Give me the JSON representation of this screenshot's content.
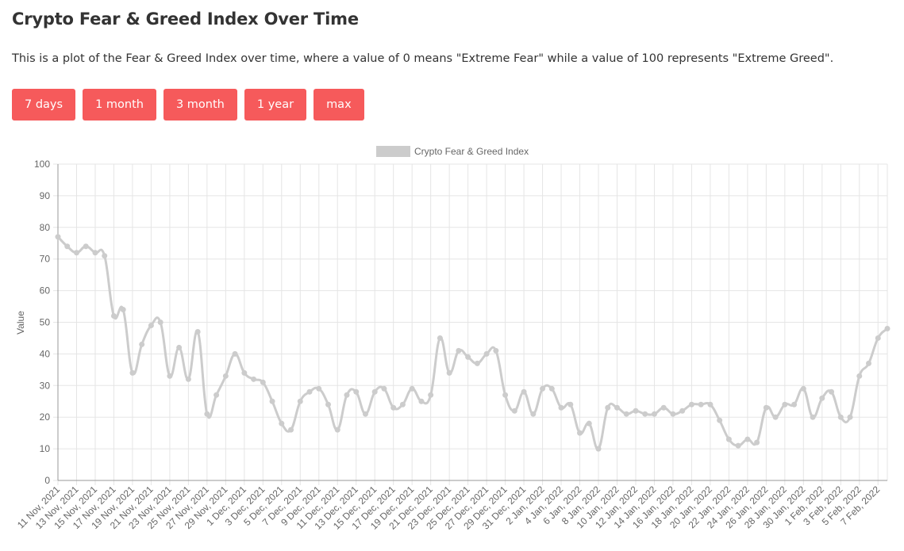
{
  "header": {
    "title": "Crypto Fear & Greed Index Over Time",
    "description": "This is a plot of the Fear & Greed Index over time, where a value of 0 means \"Extreme Fear\" while a value of 100 represents \"Extreme Greed\"."
  },
  "range_buttons": [
    {
      "label": "7 days"
    },
    {
      "label": "1 month"
    },
    {
      "label": "3 month"
    },
    {
      "label": "1 year"
    },
    {
      "label": "max"
    }
  ],
  "colors": {
    "button_bg": "#f65a5b",
    "series": "#cccccc"
  },
  "chart_data": {
    "type": "line",
    "title": "",
    "xlabel": "",
    "ylabel": "Value",
    "ylim": [
      0,
      100
    ],
    "y_ticks": [
      0,
      10,
      20,
      30,
      40,
      50,
      60,
      70,
      80,
      90,
      100
    ],
    "grid": true,
    "legend_position": "top-center",
    "x": [
      "11 Nov, 2021",
      "12 Nov, 2021",
      "13 Nov, 2021",
      "14 Nov, 2021",
      "15 Nov, 2021",
      "16 Nov, 2021",
      "17 Nov, 2021",
      "18 Nov, 2021",
      "19 Nov, 2021",
      "20 Nov, 2021",
      "21 Nov, 2021",
      "22 Nov, 2021",
      "23 Nov, 2021",
      "24 Nov, 2021",
      "25 Nov, 2021",
      "26 Nov, 2021",
      "27 Nov, 2021",
      "28 Nov, 2021",
      "29 Nov, 2021",
      "30 Nov, 2021",
      "1 Dec, 2021",
      "2 Dec, 2021",
      "3 Dec, 2021",
      "4 Dec, 2021",
      "5 Dec, 2021",
      "6 Dec, 2021",
      "7 Dec, 2021",
      "8 Dec, 2021",
      "9 Dec, 2021",
      "10 Dec, 2021",
      "11 Dec, 2021",
      "12 Dec, 2021",
      "13 Dec, 2021",
      "14 Dec, 2021",
      "15 Dec, 2021",
      "16 Dec, 2021",
      "17 Dec, 2021",
      "18 Dec, 2021",
      "19 Dec, 2021",
      "20 Dec, 2021",
      "21 Dec, 2021",
      "22 Dec, 2021",
      "23 Dec, 2021",
      "24 Dec, 2021",
      "25 Dec, 2021",
      "26 Dec, 2021",
      "27 Dec, 2021",
      "28 Dec, 2021",
      "29 Dec, 2021",
      "30 Dec, 2021",
      "31 Dec, 2021",
      "1 Jan, 2022",
      "2 Jan, 2022",
      "3 Jan, 2022",
      "4 Jan, 2022",
      "5 Jan, 2022",
      "6 Jan, 2022",
      "7 Jan, 2022",
      "8 Jan, 2022",
      "9 Jan, 2022",
      "10 Jan, 2022",
      "11 Jan, 2022",
      "12 Jan, 2022",
      "13 Jan, 2022",
      "14 Jan, 2022",
      "15 Jan, 2022",
      "16 Jan, 2022",
      "17 Jan, 2022",
      "18 Jan, 2022",
      "19 Jan, 2022",
      "20 Jan, 2022",
      "21 Jan, 2022",
      "22 Jan, 2022",
      "23 Jan, 2022",
      "24 Jan, 2022",
      "25 Jan, 2022",
      "26 Jan, 2022",
      "27 Jan, 2022",
      "28 Jan, 2022",
      "29 Jan, 2022",
      "30 Jan, 2022",
      "31 Jan, 2022",
      "1 Feb, 2022",
      "2 Feb, 2022",
      "3 Feb, 2022",
      "4 Feb, 2022",
      "5 Feb, 2022",
      "6 Feb, 2022",
      "7 Feb, 2022",
      "8 Feb, 2022"
    ],
    "x_tick_step": 2,
    "series": [
      {
        "name": "Crypto Fear & Greed Index",
        "values": [
          77,
          74,
          72,
          74,
          72,
          71,
          52,
          54,
          34,
          43,
          49,
          50,
          33,
          42,
          32,
          47,
          21,
          27,
          33,
          40,
          34,
          32,
          31,
          25,
          18,
          16,
          25,
          28,
          29,
          24,
          16,
          27,
          28,
          21,
          28,
          29,
          23,
          24,
          29,
          25,
          27,
          45,
          34,
          41,
          39,
          37,
          40,
          41,
          27,
          22,
          28,
          21,
          29,
          29,
          23,
          24,
          15,
          18,
          10,
          23,
          23,
          21,
          22,
          21,
          21,
          23,
          21,
          22,
          24,
          24,
          24,
          19,
          13,
          11,
          13,
          12,
          23,
          20,
          24,
          24,
          29,
          20,
          26,
          28,
          20,
          20,
          33,
          37,
          45,
          48
        ]
      }
    ]
  }
}
